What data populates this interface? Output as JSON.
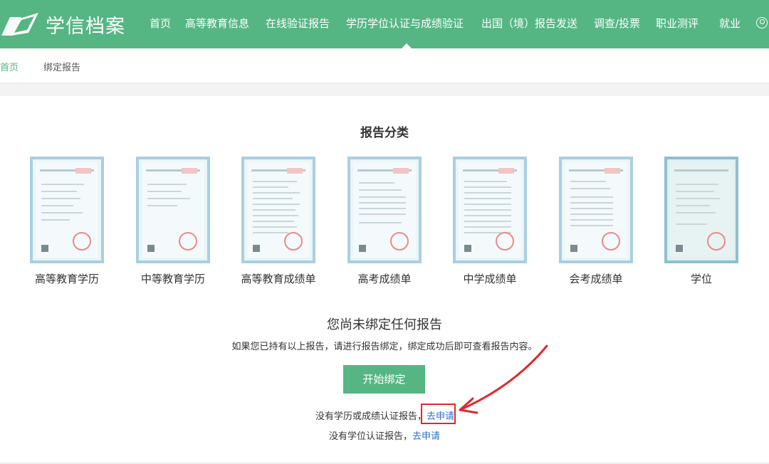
{
  "header": {
    "site_name": "学信档案",
    "nav": [
      {
        "label": "首页"
      },
      {
        "label": "高等教育信息"
      },
      {
        "label": "在线验证报告"
      },
      {
        "label": "学历学位认证与成绩验证"
      },
      {
        "label": "出国（境）报告发送"
      },
      {
        "label": "调查/投票"
      },
      {
        "label": "职业测评"
      },
      {
        "label": "就业"
      }
    ],
    "active_nav": "学历学位认证与成绩验证",
    "brand_color": "#55b684"
  },
  "breadcrumb": {
    "home": "首页",
    "current": "绑定报告"
  },
  "reports": {
    "title": "报告分类",
    "items": [
      {
        "label": "高等教育学历"
      },
      {
        "label": "中等教育学历"
      },
      {
        "label": "高等教育成绩单"
      },
      {
        "label": "高考成绩单"
      },
      {
        "label": "中学成绩单"
      },
      {
        "label": "会考成绩单"
      },
      {
        "label": "学位"
      }
    ]
  },
  "empty": {
    "title": "您尚未绑定任何报告",
    "description": "如果您已持有以上报告，请进行报告绑定，绑定成功后即可查看报告内容。",
    "bind_button": "开始绑定",
    "line1_text": "没有学历或成绩认证报告，",
    "line1_link": "去申请",
    "line2_text": "没有学位认证报告，",
    "line2_link": "去申请",
    "link_color": "#2a6fc9",
    "highlight_color": "#e3262b"
  }
}
